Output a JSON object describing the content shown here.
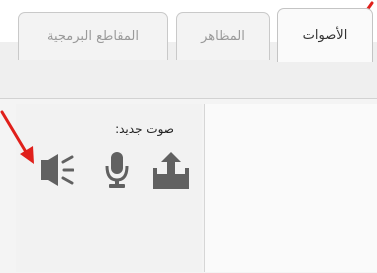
{
  "tabs": {
    "sounds": "الأصوات",
    "costumes": "المظاهر",
    "code": "المقاطع البرمجية"
  },
  "new_sound": {
    "label": "صوت جديد:"
  },
  "icons": {
    "library": "speaker-icon",
    "record": "microphone-icon",
    "upload": "upload-icon"
  },
  "colors": {
    "arrow": "#e0201b",
    "icon": "#616161"
  }
}
